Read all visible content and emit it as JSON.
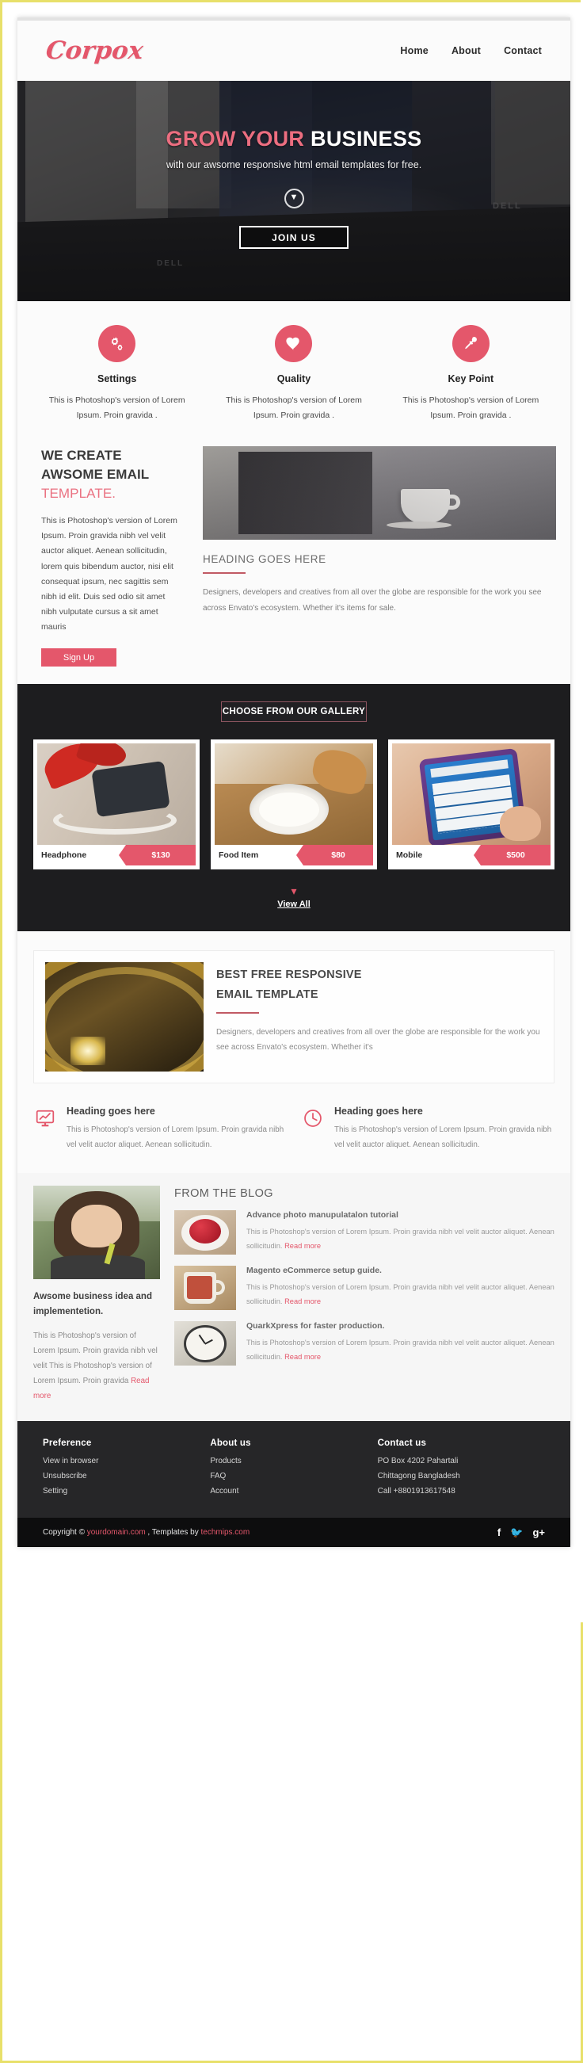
{
  "brand": {
    "logo": "Corpox",
    "accent": "#e4576b",
    "dark": "#1d1d1f"
  },
  "nav": {
    "items": [
      {
        "label": "Home"
      },
      {
        "label": "About"
      },
      {
        "label": "Contact"
      }
    ]
  },
  "hero": {
    "title_accent": "GROW YOUR",
    "title_plain": " BUSINESS",
    "subtitle": "with our awsome responsive html email templates for free.",
    "scroll_icon": "chevron-down-icon",
    "cta": "JOIN US",
    "bg_label_1": "DELL",
    "bg_label_2": "DELL"
  },
  "features": [
    {
      "icon": "gears-icon",
      "title": "Settings",
      "text": "This is Photoshop's version  of Lorem Ipsum. Proin gravida ."
    },
    {
      "icon": "heart-icon",
      "title": "Quality",
      "text": "This is Photoshop's version  of Lorem Ipsum. Proin gravida ."
    },
    {
      "icon": "pushpin-icon",
      "title": "Key Point",
      "text": "This is Photoshop's version  of Lorem Ipsum. Proin gravida ."
    }
  ],
  "create": {
    "heading_line1": "WE CREATE",
    "heading_line2": "AWSOME EMAIL",
    "heading_line3": "TEMPLATE.",
    "body": "This is Photoshop's version  of Lorem Ipsum. Proin gravida nibh vel velit auctor aliquet. Aenean sollicitudin, lorem quis bibendum auctor, nisi elit consequat ipsum, nec sagittis sem nibh id elit. Duis sed odio sit amet nibh vulputate cursus a sit amet mauris",
    "button": "Sign Up",
    "side_heading": "HEADING GOES HERE",
    "side_body": "Designers, developers and creatives from all over the globe are responsible for the work you see across Envato's ecosystem. Whether it's items for sale."
  },
  "gallery": {
    "badge": "CHOOSE FROM OUR GALLERY",
    "items": [
      {
        "name": "Headphone",
        "price": "$130",
        "art": "t1"
      },
      {
        "name": "Food Item",
        "price": "$80",
        "art": "t2"
      },
      {
        "name": "Mobile",
        "price": "$500",
        "art": "t3"
      }
    ],
    "view_all": "View All",
    "view_all_icon": "chevron-down-icon"
  },
  "best": {
    "heading_line1": "BEST FREE RESPONSIVE",
    "heading_line2": "EMAIL TEMPLATE",
    "body": "Designers, developers and creatives from all over the globe are responsible for the work you see across Envato's ecosystem. Whether it's"
  },
  "two_headings": [
    {
      "icon": "monitor-chart-icon",
      "title": "Heading goes here",
      "text": "This is Photoshop's version  of Lorem Ipsum. Proin gravida nibh vel velit auctor aliquet. Aenean sollicitudin."
    },
    {
      "icon": "clock-icon",
      "title": "Heading goes here",
      "text": "This is Photoshop's version  of Lorem Ipsum. Proin gravida nibh vel velit auctor aliquet. Aenean sollicitudin."
    }
  ],
  "blog": {
    "side": {
      "heading": "Awsome business idea and implementetion.",
      "text": "This is Photoshop's version  of Lorem Ipsum. Proin gravida nibh vel velit  This is Photoshop's version  of Lorem Ipsum. Proin gravida ",
      "read_more": "Read more"
    },
    "title": "FROM THE BLOG",
    "posts": [
      {
        "art": "pt1",
        "title": "Advance photo manupulatalon tutorial",
        "text": "This is Photoshop's version  of Lorem Ipsum. Proin gravida nibh vel velit auctor aliquet. Aenean sollicitudin. ",
        "read_more": "Read more"
      },
      {
        "art": "pt2",
        "title": "Magento eCommerce setup guide.",
        "text": "This is Photoshop's version  of Lorem Ipsum. Proin gravida nibh vel velit auctor aliquet. Aenean sollicitudin. ",
        "read_more": "Read more"
      },
      {
        "art": "pt3",
        "title": "QuarkXpress for faster production.",
        "text": "This is Photoshop's version  of Lorem Ipsum. Proin gravida nibh vel velit auctor aliquet. Aenean sollicitudin. ",
        "read_more": "Read more"
      }
    ]
  },
  "footer": {
    "columns": [
      {
        "title": "Preference",
        "links": [
          "View in browser",
          "Unsubscribe",
          "Setting"
        ]
      },
      {
        "title": "About us",
        "links": [
          "Products",
          "FAQ",
          "Account"
        ]
      },
      {
        "title": "Contact us",
        "links": [
          "PO Box 4202 Pahartali",
          "Chittagong Bangladesh",
          "Call +8801913617548"
        ]
      }
    ],
    "copyright_pre": "Copyright © ",
    "copyright_domain": "yourdomain.com",
    "copyright_mid": " , Templates by ",
    "copyright_author": "techmips.com",
    "socials": [
      {
        "icon": "facebook-icon",
        "glyph": "f"
      },
      {
        "icon": "twitter-icon",
        "glyph": "🐦"
      },
      {
        "icon": "googleplus-icon",
        "glyph": "g+"
      }
    ]
  }
}
